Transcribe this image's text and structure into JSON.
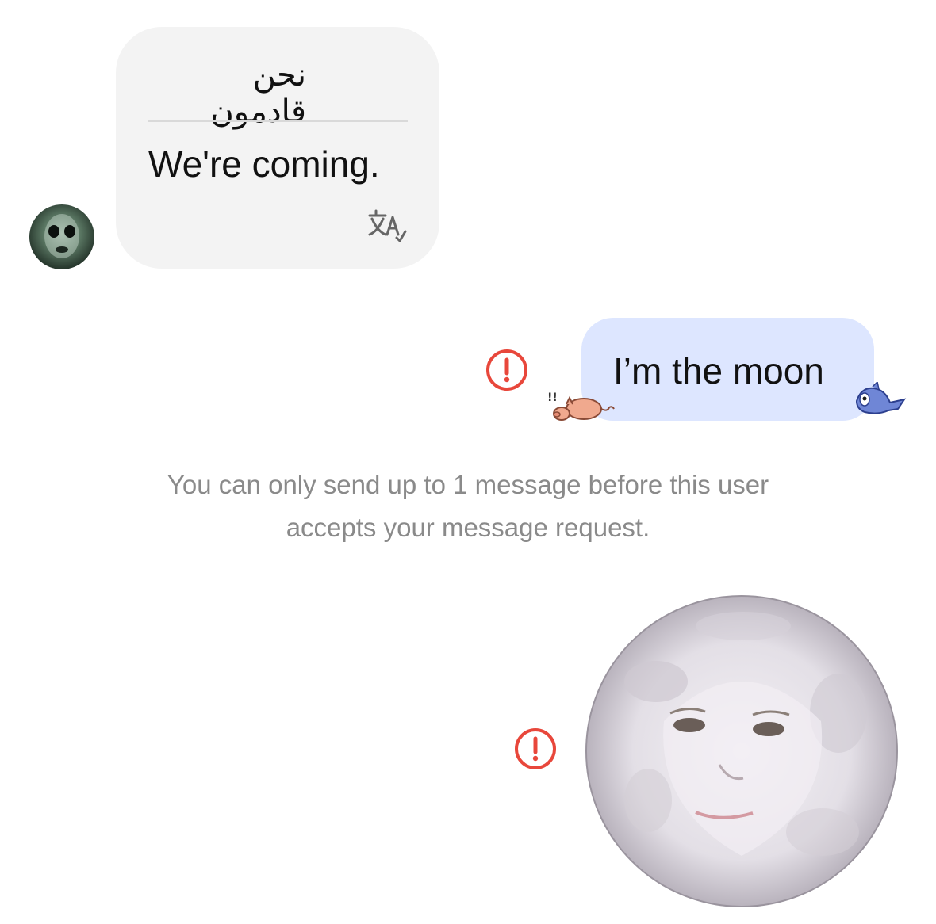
{
  "incoming": {
    "original_text": "نحن قادمون",
    "translated_text": "We're coming.",
    "translate_icon": "translate-icon",
    "avatar": "sender-avatar-dark-face"
  },
  "outgoing": {
    "text": "I’m the moon",
    "error_icon": "error-exclamation-icon",
    "stickers": [
      "pig-sticker",
      "blue-shark-sticker"
    ],
    "image": "moon-face-image"
  },
  "notice": {
    "line1": "You can only send up to 1 message before this user",
    "line2": "accepts your message request."
  },
  "colors": {
    "incoming_bubble": "#f3f3f3",
    "outgoing_bubble": "#dde6ff",
    "error_red": "#e8473b",
    "notice_text": "#8a8a8a"
  }
}
